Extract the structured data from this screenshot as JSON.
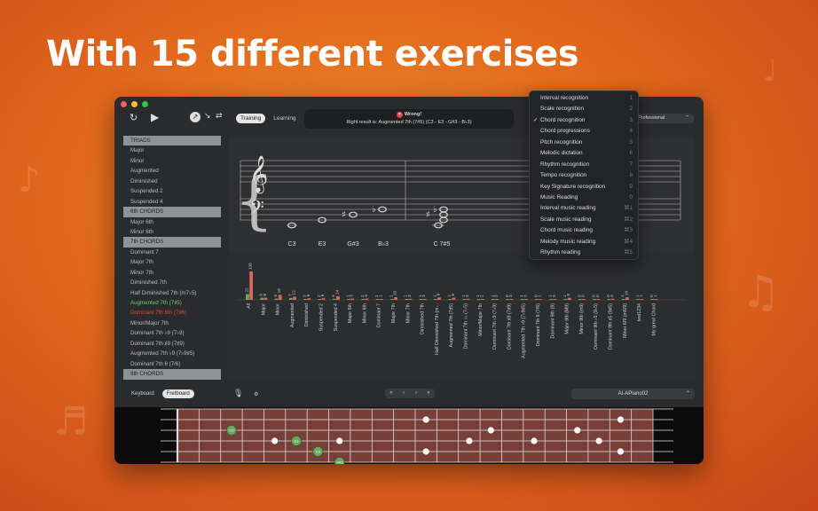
{
  "headline": "With 15 different exercises",
  "window": {
    "traffic_lights": [
      "#ff5f57",
      "#febc2e",
      "#28c840"
    ],
    "toolbar": {
      "tabs": [
        {
          "label": "Training",
          "active": true
        },
        {
          "label": "Learning",
          "active": false
        }
      ],
      "result": {
        "status": "Wrong!",
        "detail": "Right result is: Augmented 7th (7#5) (C3 - E3 - G#3 - B♭3)"
      },
      "level_label": "Professional"
    },
    "sidebar": [
      {
        "label": "TRIADS",
        "kind": "header"
      },
      {
        "label": "Major"
      },
      {
        "label": "Minor"
      },
      {
        "label": "Augmented"
      },
      {
        "label": "Diminished"
      },
      {
        "label": "Suspended 2"
      },
      {
        "label": "Suspended 4"
      },
      {
        "label": "6th CHORDS",
        "kind": "header"
      },
      {
        "label": "Major 6th"
      },
      {
        "label": "Minor 6th"
      },
      {
        "label": "7th CHORDS",
        "kind": "header"
      },
      {
        "label": "Dominant 7"
      },
      {
        "label": "Major 7th"
      },
      {
        "label": "Minor 7th"
      },
      {
        "label": "Diminished 7th"
      },
      {
        "label": "Half Diminished 7th (m7♭5)"
      },
      {
        "label": "Augmented 7th (7♯5)",
        "kind": "correct"
      },
      {
        "label": "Dominant 7th 6th (7♯6)",
        "kind": "wrong"
      },
      {
        "label": "Minor/Major 7th"
      },
      {
        "label": "Dominant 7th ♭9 (7♭9)"
      },
      {
        "label": "Dominant 7th ♯9 (7♯9)"
      },
      {
        "label": "Augmented 7th ♭9 (7♭9♯5)"
      },
      {
        "label": "Dominant 7th 6 (7/6)"
      },
      {
        "label": "9th CHORDS",
        "kind": "header"
      }
    ],
    "staff": {
      "note_labels": [
        "C3",
        "E3",
        "G#3",
        "B♭3",
        "C 7#5"
      ]
    },
    "bottombar": {
      "keyboard_tabs": [
        {
          "label": "Keyboard",
          "active": false
        },
        {
          "label": "Fretboard",
          "active": true
        }
      ],
      "nav": [
        "«",
        "‹",
        "›",
        "»"
      ],
      "sound": "AI-APiano02"
    }
  },
  "menu": [
    {
      "label": "Interval recognition",
      "shortcut": "1",
      "checked": false
    },
    {
      "label": "Scale recognition",
      "shortcut": "2",
      "checked": false
    },
    {
      "label": "Chord recognition",
      "shortcut": "3",
      "checked": true
    },
    {
      "label": "Chord progressions",
      "shortcut": "4",
      "checked": false
    },
    {
      "label": "Pitch recognition",
      "shortcut": "5",
      "checked": false
    },
    {
      "label": "Melodic dictation",
      "shortcut": "6",
      "checked": false
    },
    {
      "label": "Rhythm recognition",
      "shortcut": "7",
      "checked": false
    },
    {
      "label": "Tempo recognition",
      "shortcut": "8",
      "checked": false
    },
    {
      "label": "Key Signature recognition",
      "shortcut": "9",
      "checked": false
    },
    {
      "label": "Music Reading",
      "shortcut": "0",
      "checked": false
    },
    {
      "label": "Interval music reading",
      "shortcut": "⌘1",
      "checked": false
    },
    {
      "label": "Scale music reading",
      "shortcut": "⌘2",
      "checked": false
    },
    {
      "label": "Chord music reading",
      "shortcut": "⌘3",
      "checked": false
    },
    {
      "label": "Melody music reading",
      "shortcut": "⌘4",
      "checked": false
    },
    {
      "label": "Rhythm reading",
      "shortcut": "⌘5",
      "checked": false
    }
  ],
  "chart_data": {
    "type": "bar",
    "categories": [
      "All",
      "Major",
      "Minor",
      "Augmented",
      "Diminished",
      "Suspended 2",
      "Suspended 4",
      "Major 6th",
      "Minor 6th",
      "Dominant 7",
      "Major 7th",
      "Minor 7th",
      "Diminished 7th",
      "Half Diminished 7th (m...",
      "Augmented 7th (7♯5)",
      "Dominant 7th ♭♭ (7♭5)",
      "Minor/Major 7th",
      "Dominant 7th ♭9 (7♭9)",
      "Dominant 7th ♯9 (7♯9)",
      "Augmented 7th ♭9 (7♭9♯5)",
      "Dominant 7th 6 (7/6)",
      "Dominant 9th (9)",
      "Major 9th (M9)",
      "Minor 9th (m9)",
      "Dominant 9th ♭5 (9♭5)",
      "Dominant 9th ♯5 (9♯5)",
      "Minor 6/9 (m6/9)",
      "test1234",
      "My great Chord"
    ],
    "series": [
      {
        "values": [
          22,
          8,
          5,
          7,
          3,
          2,
          4,
          1,
          2,
          1,
          1,
          1,
          1,
          1,
          1,
          1,
          1,
          1,
          0,
          1,
          0,
          1,
          1,
          0,
          0,
          0,
          1,
          1,
          0
        ],
        "color": "#67a95c"
      },
      {
        "values": [
          108,
          8,
          19,
          12,
          6,
          6,
          14,
          5,
          5,
          1,
          10,
          4,
          3,
          9,
          8,
          4,
          2,
          3,
          3,
          3,
          1,
          3,
          8,
          0,
          0,
          4,
          10,
          1,
          1
        ],
        "color": "#d4685a"
      }
    ]
  },
  "fretboard_data": {
    "strings": 6,
    "frets": 22,
    "markers": [
      {
        "fret": 3,
        "string": 2,
        "label": "C3",
        "green": true
      },
      {
        "fret": 5,
        "string": 3,
        "label": "",
        "green": false
      },
      {
        "fret": 6,
        "string": 3,
        "label": "E3",
        "green": true
      },
      {
        "fret": 7,
        "string": 4,
        "label": "E3",
        "green": true
      },
      {
        "fret": 8,
        "string": 3,
        "label": "",
        "green": false
      },
      {
        "fret": 8,
        "string": 5,
        "label": "G#3",
        "green": true
      },
      {
        "fret": 12,
        "string": 1,
        "label": "",
        "green": false
      },
      {
        "fret": 12,
        "string": 4,
        "label": "",
        "green": false
      },
      {
        "fret": 14,
        "string": 3,
        "label": "",
        "green": false
      },
      {
        "fret": 15,
        "string": 2,
        "label": "",
        "green": false
      },
      {
        "fret": 17,
        "string": 3,
        "label": "",
        "green": false
      },
      {
        "fret": 19,
        "string": 2,
        "label": "",
        "green": false
      },
      {
        "fret": 20,
        "string": 3,
        "label": "",
        "green": false
      },
      {
        "fret": 21,
        "string": 1,
        "label": "",
        "green": false
      },
      {
        "fret": 21,
        "string": 4,
        "label": "",
        "green": false
      }
    ]
  }
}
